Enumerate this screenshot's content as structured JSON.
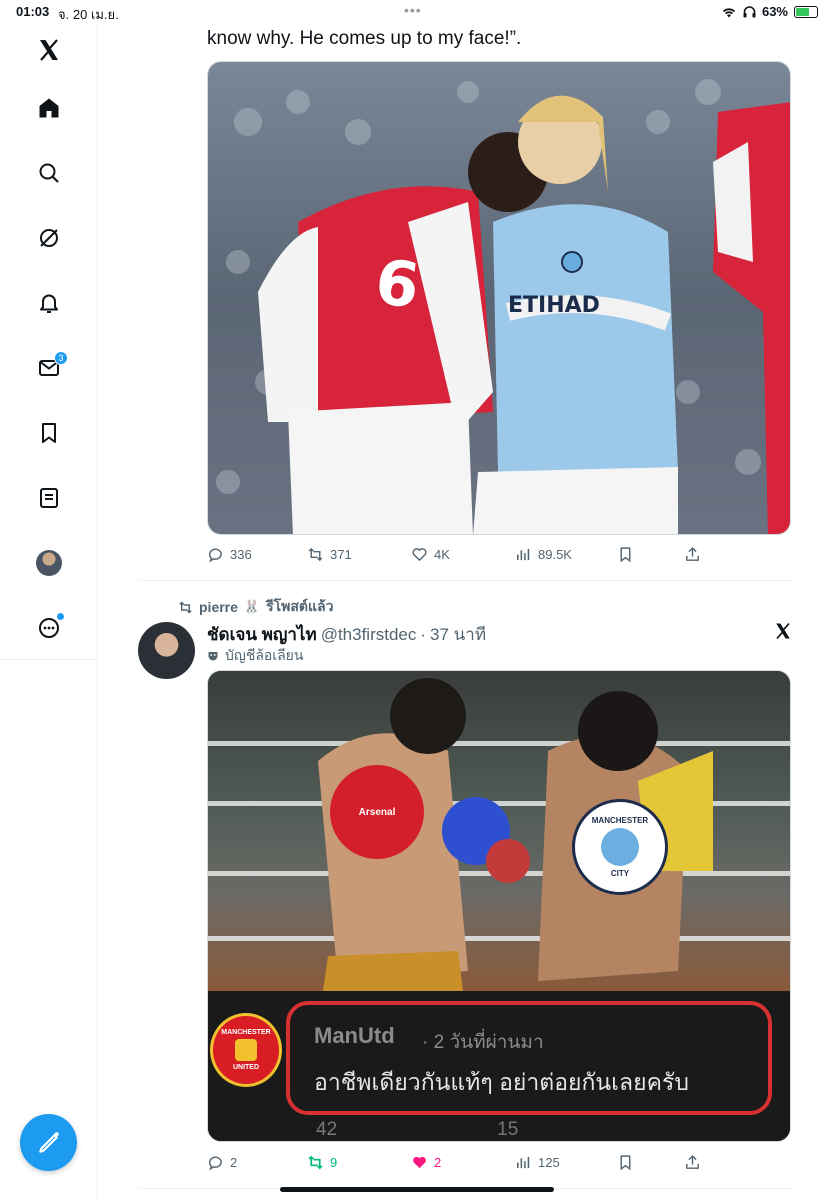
{
  "status_bar": {
    "time": "01:03",
    "date": "จ. 20 เม.ย.",
    "battery": "63%",
    "battery_level": 0.63
  },
  "sidebar": {
    "messages_badge": "3"
  },
  "tweet1": {
    "text_tail": "know why. He comes up to my face!”.",
    "stats": {
      "replies": "336",
      "reposts": "371",
      "likes": "4K",
      "views": "89.5K"
    }
  },
  "tweet2": {
    "retweeted_by": "pierre",
    "retweeted_label": "รีโพสต์แล้ว",
    "author_name": "ชัดเจน พญาไท",
    "handle": "@th3firstdec",
    "separator": "·",
    "time_ago": "37 นาที",
    "parody_label": "บัญชีล้อเลียน",
    "image": {
      "badge_arsenal": "Arsenal",
      "badge_city_top": "MANCHESTER",
      "badge_city_bottom": "CITY",
      "badge_united_top": "MANCHESTER",
      "badge_united_bottom": "UNITED",
      "reply_user": "ManUtd",
      "reply_time": "· 2 วันที่ผ่านมา",
      "reply_text": "อาชีพเดียวกันแท้ๆ อย่าต่อยกันเลยครับ",
      "reply_likes": "42",
      "reply_comments": "15"
    },
    "stats": {
      "replies": "2",
      "reposts": "9",
      "likes": "2",
      "views": "125"
    }
  },
  "colors": {
    "accent": "#1d9bf0",
    "repost_green": "#00ba7c",
    "like_pink": "#f91880",
    "muted": "#536471"
  }
}
